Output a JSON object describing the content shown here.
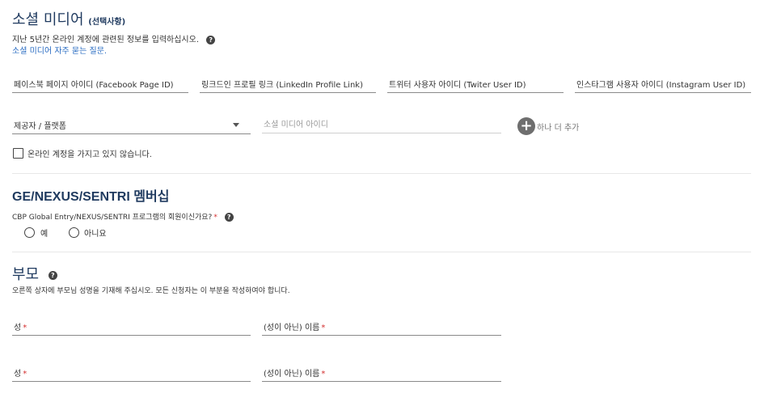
{
  "social": {
    "title": "소셜 미디어",
    "optional": "(선택사항)",
    "description": "지난 5년간 온라인 계정에 관련된 정보를 입력하십시오.",
    "faq_link": "소셜 미디어 자주 묻는 질문.",
    "fields": [
      "페이스북 페이지 아이디 (Facebook Page ID)",
      "링크드인 프로필 링크 (LinkedIn Profile Link)",
      "트위터 사용자 아이디 (Twiter User ID)",
      "인스타그램 사용자 아이디 (Instagram User ID)"
    ],
    "provider_select": "제공자 / 플랫폼",
    "id_placeholder": "소셜 미디어 아이디",
    "add_more": "하나 더 추가",
    "no_account": "온라인 계정을 가지고 있지 않습니다."
  },
  "membership": {
    "title": "GE/NEXUS/SENTRI 멤버십",
    "question": "CBP Global Entry/NEXUS/SENTRI 프로그램의 회원이신가요?",
    "required_mark": "*",
    "options": [
      "예",
      "아니요"
    ]
  },
  "parents": {
    "title": "부모",
    "description": "오른쪽 상자에 부모님 성명을 기재해 주십시오. 모든 신청자는 이 부분을 작성하여야 합니다.",
    "last_name_label": "성",
    "first_name_label": "(성이 아닌) 이름",
    "required_mark": "*"
  },
  "icons": {
    "help": "question-circle-icon",
    "add": "plus-circle-icon",
    "dropdown": "caret-down-icon"
  },
  "colors": {
    "heading": "#1f3a5f",
    "link": "#2a6cc2",
    "required": "#d32f2f"
  }
}
